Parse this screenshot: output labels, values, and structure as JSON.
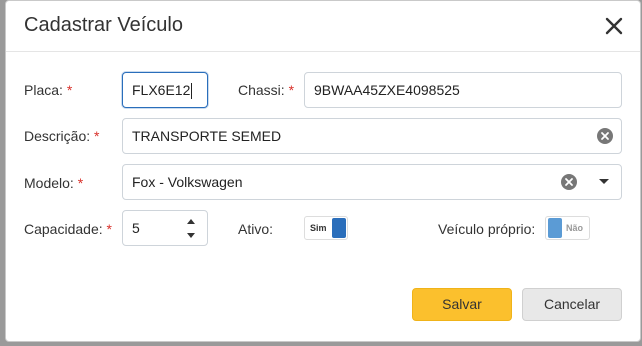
{
  "dialog": {
    "title": "Cadastrar Veículo",
    "close_icon": "close-icon"
  },
  "form": {
    "placa": {
      "label": "Placa:",
      "required_mark": "*",
      "value": "FLX6E12"
    },
    "chassi": {
      "label": "Chassi:",
      "required_mark": "*",
      "value": "9BWAA45ZXE4098525"
    },
    "descricao": {
      "label": "Descrição:",
      "required_mark": "*",
      "value": "TRANSPORTE SEMED"
    },
    "modelo": {
      "label": "Modelo:",
      "required_mark": "*",
      "value": "Fox - Volkswagen"
    },
    "capacidade": {
      "label": "Capacidade:",
      "required_mark": "*",
      "value": "5"
    },
    "ativo": {
      "label": "Ativo:",
      "toggle_text": "Sim",
      "state": true,
      "color": "#2a6ebb"
    },
    "veiculo_proprio": {
      "label": "Veículo próprio:",
      "toggle_text": "Não",
      "state": false,
      "color": "#5b9bd5"
    }
  },
  "actions": {
    "save_label": "Salvar",
    "cancel_label": "Cancelar",
    "save_color": "#fbc02d"
  }
}
